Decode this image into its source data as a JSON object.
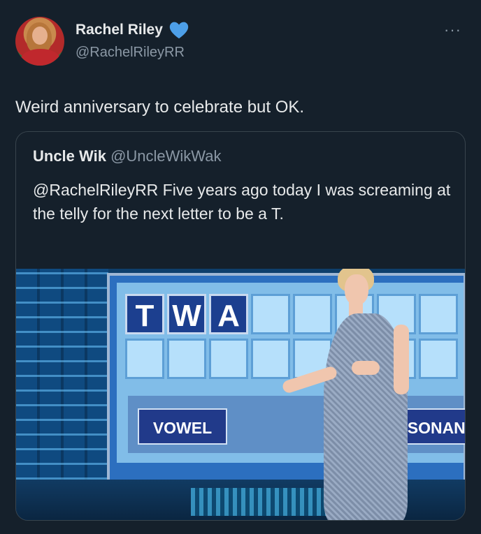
{
  "author": {
    "name": "Rachel Riley",
    "handle": "@RachelRileyRR",
    "verified_icon": "blue-heart-icon",
    "heart_color": "#4d9fe8"
  },
  "more_icon_label": "···",
  "tweet": {
    "text": "Weird anniversary to celebrate but OK."
  },
  "quoted": {
    "name": "Uncle Wik",
    "handle": "@UncleWikWak",
    "text": "@RachelRileyRR Five years ago today I was screaming at the telly for the next letter to be a T."
  },
  "image": {
    "letters": [
      "T",
      "W",
      "A"
    ],
    "vowel_label": "VOWEL",
    "consonant_label": "NSONANT"
  }
}
